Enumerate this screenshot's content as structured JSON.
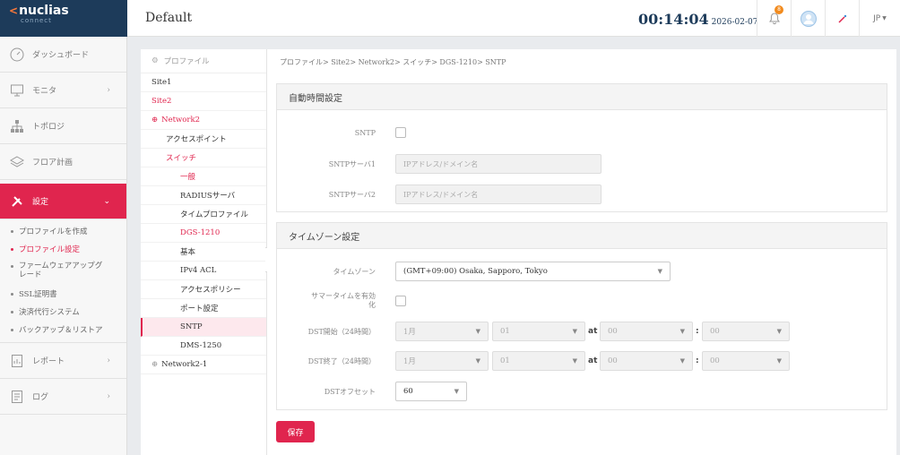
{
  "header": {
    "brand": "nuclias",
    "brand_sub": "connect",
    "site_name": "Default",
    "clock_time": "00:14:04",
    "clock_date": "2026-02-07",
    "notification_count": "8",
    "language": "JP"
  },
  "sidebar": {
    "items": [
      {
        "label": "ダッシュボード",
        "icon": "dashboard-icon"
      },
      {
        "label": "モニタ",
        "icon": "monitor-icon"
      },
      {
        "label": "トポロジ",
        "icon": "topology-icon"
      },
      {
        "label": "フロア計画",
        "icon": "floorplan-icon"
      },
      {
        "label": "設定",
        "icon": "settings-icon"
      },
      {
        "label": "レポート",
        "icon": "report-icon"
      },
      {
        "label": "ログ",
        "icon": "log-icon"
      }
    ],
    "sub_items": [
      "プロファイルを作成",
      "プロファイル設定",
      "ファームウェアアップグレード",
      "SSL証明書",
      "決済代行システム",
      "バックアップ＆リストア"
    ]
  },
  "tree": {
    "header": "プロファイル",
    "rows": [
      "Site1",
      "Site2",
      "Network2",
      "アクセスポイント",
      "スイッチ",
      "一般",
      "RADIUSサーバ",
      "タイムプロファイル",
      "DGS-1210",
      "基本",
      "IPv4 ACL",
      "アクセスポリシー",
      "ポート設定",
      "SNTP",
      "DMS-1250",
      "Network2-1"
    ]
  },
  "breadcrumb": "プロファイル> Site2> Network2> スイッチ> DGS-1210> SNTP",
  "sntp_panel": {
    "title": "自動時間設定",
    "sntp_label": "SNTP",
    "server1_label": "SNTPサーバ1",
    "server2_label": "SNTPサーバ2",
    "server_placeholder": "IPアドレス/ドメイン名"
  },
  "tz_panel": {
    "title": "タイムゾーン設定",
    "timezone_label": "タイムゾーン",
    "timezone_value": "(GMT+09:00) Osaka, Sapporo, Tokyo",
    "summer_label_1": "サマータイムを有効",
    "summer_label_2": "化",
    "dst_start_label": "DST開始（24時間）",
    "dst_end_label": "DST終了（24時間）",
    "month_value": "1月",
    "day_value": "01",
    "at_label": "at",
    "hour_value": "00",
    "colon": ":",
    "minute_value": "00",
    "offset_label": "DSTオフセット",
    "offset_value": "60"
  },
  "save_label": "保存",
  "colors": {
    "accent": "#e0254e",
    "logo_bg": "#1d3b5a"
  }
}
